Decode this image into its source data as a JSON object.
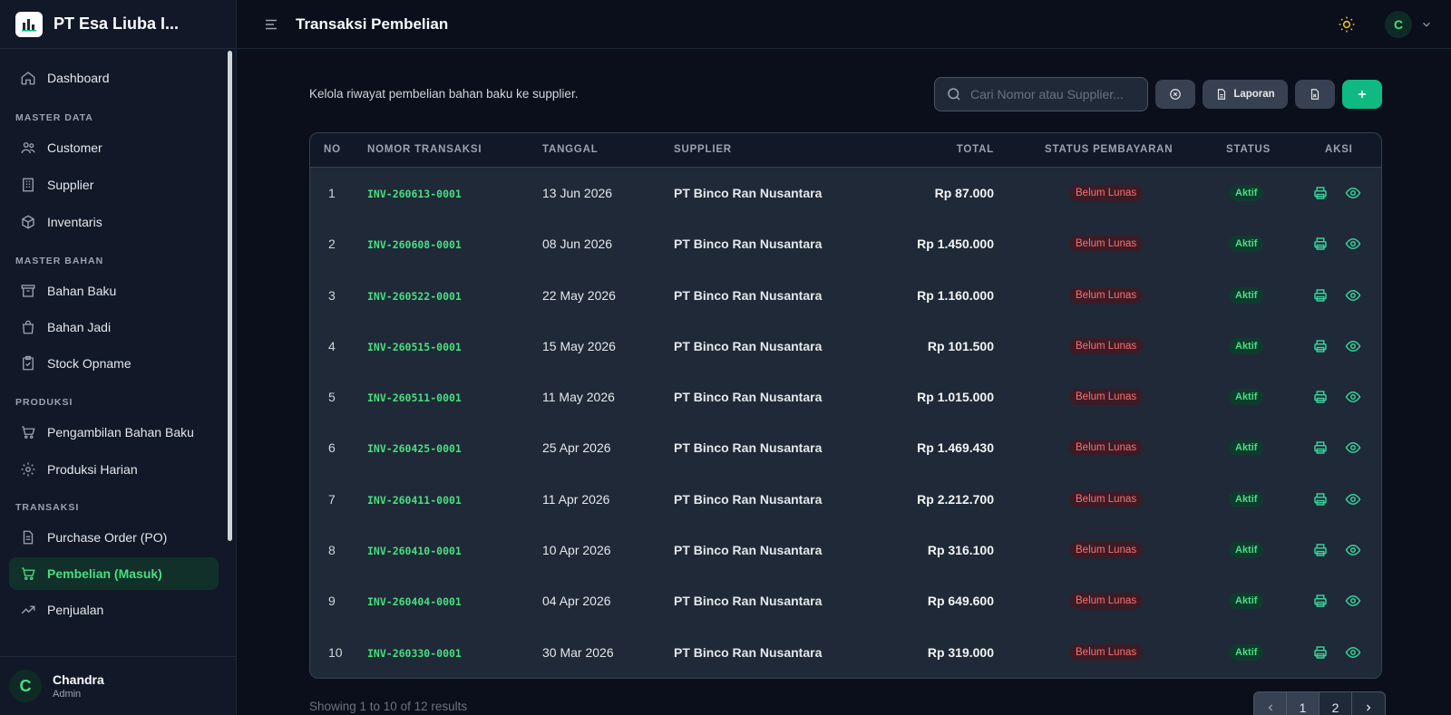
{
  "brand": {
    "name": "PT Esa Liuba I..."
  },
  "header": {
    "title": "Transaksi Pembelian",
    "avatar_initial": "C"
  },
  "sidebar": {
    "dashboard": "Dashboard",
    "section_master_data": "MASTER DATA",
    "customer": "Customer",
    "supplier": "Supplier",
    "inventaris": "Inventaris",
    "section_master_bahan": "MASTER BAHAN",
    "bahan_baku": "Bahan Baku",
    "bahan_jadi": "Bahan Jadi",
    "stock_opname": "Stock Opname",
    "section_produksi": "PRODUKSI",
    "pengambilan": "Pengambilan Bahan Baku",
    "produksi_harian": "Produksi Harian",
    "section_transaksi": "TRANSAKSI",
    "purchase_order": "Purchase Order (PO)",
    "pembelian": "Pembelian (Masuk)",
    "penjualan": "Penjualan"
  },
  "user": {
    "initial": "C",
    "name": "Chandra",
    "role": "Admin"
  },
  "main": {
    "subtitle": "Kelola riwayat pembelian bahan baku ke supplier.",
    "search_placeholder": "Cari Nomor atau Supplier...",
    "report_label": "Laporan"
  },
  "table": {
    "headers": {
      "no": "NO",
      "nomor": "NOMOR TRANSAKSI",
      "tanggal": "TANGGAL",
      "supplier": "SUPPLIER",
      "total": "TOTAL",
      "status_pembayaran": "STATUS PEMBAYARAN",
      "status": "STATUS",
      "aksi": "AKSI"
    },
    "rows": [
      {
        "no": "1",
        "nomor": "INV-260613-0001",
        "tanggal": "13 Jun 2026",
        "supplier": "PT Binco Ran Nusantara",
        "total": "Rp 87.000",
        "pembayaran": "Belum Lunas",
        "status": "Aktif"
      },
      {
        "no": "2",
        "nomor": "INV-260608-0001",
        "tanggal": "08 Jun 2026",
        "supplier": "PT Binco Ran Nusantara",
        "total": "Rp 1.450.000",
        "pembayaran": "Belum Lunas",
        "status": "Aktif"
      },
      {
        "no": "3",
        "nomor": "INV-260522-0001",
        "tanggal": "22 May 2026",
        "supplier": "PT Binco Ran Nusantara",
        "total": "Rp 1.160.000",
        "pembayaran": "Belum Lunas",
        "status": "Aktif"
      },
      {
        "no": "4",
        "nomor": "INV-260515-0001",
        "tanggal": "15 May 2026",
        "supplier": "PT Binco Ran Nusantara",
        "total": "Rp 101.500",
        "pembayaran": "Belum Lunas",
        "status": "Aktif"
      },
      {
        "no": "5",
        "nomor": "INV-260511-0001",
        "tanggal": "11 May 2026",
        "supplier": "PT Binco Ran Nusantara",
        "total": "Rp 1.015.000",
        "pembayaran": "Belum Lunas",
        "status": "Aktif"
      },
      {
        "no": "6",
        "nomor": "INV-260425-0001",
        "tanggal": "25 Apr 2026",
        "supplier": "PT Binco Ran Nusantara",
        "total": "Rp 1.469.430",
        "pembayaran": "Belum Lunas",
        "status": "Aktif"
      },
      {
        "no": "7",
        "nomor": "INV-260411-0001",
        "tanggal": "11 Apr 2026",
        "supplier": "PT Binco Ran Nusantara",
        "total": "Rp 2.212.700",
        "pembayaran": "Belum Lunas",
        "status": "Aktif"
      },
      {
        "no": "8",
        "nomor": "INV-260410-0001",
        "tanggal": "10 Apr 2026",
        "supplier": "PT Binco Ran Nusantara",
        "total": "Rp 316.100",
        "pembayaran": "Belum Lunas",
        "status": "Aktif"
      },
      {
        "no": "9",
        "nomor": "INV-260404-0001",
        "tanggal": "04 Apr 2026",
        "supplier": "PT Binco Ran Nusantara",
        "total": "Rp 649.600",
        "pembayaran": "Belum Lunas",
        "status": "Aktif"
      },
      {
        "no": "10",
        "nomor": "INV-260330-0001",
        "tanggal": "30 Mar 2026",
        "supplier": "PT Binco Ran Nusantara",
        "total": "Rp 319.000",
        "pembayaran": "Belum Lunas",
        "status": "Aktif"
      }
    ]
  },
  "pagination": {
    "summary": "Showing 1 to 10 of 12 results",
    "pages": [
      "1",
      "2"
    ]
  }
}
